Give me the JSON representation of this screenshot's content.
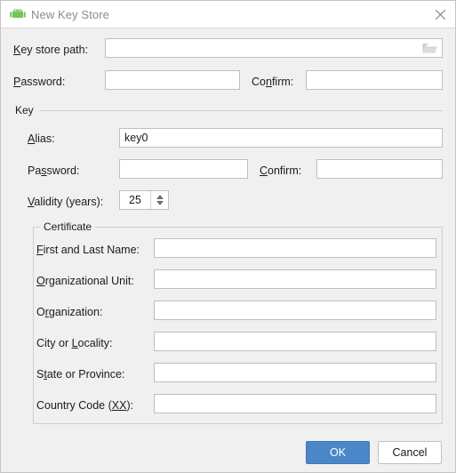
{
  "window": {
    "title": "New Key Store",
    "icon": "android-robot-icon",
    "close_icon": "close-icon"
  },
  "keystore": {
    "path_label_pre": "",
    "path_label_mnemonic": "K",
    "path_label_post": "ey store path:",
    "path_value": "",
    "browse_icon": "folder-icon",
    "password_label_mnemonic": "P",
    "password_label_post": "assword:",
    "password_value": "",
    "confirm_label_pre": "Co",
    "confirm_label_mnemonic": "n",
    "confirm_label_post": "firm:",
    "confirm_value": ""
  },
  "key_group": {
    "legend": "Key",
    "alias_label_mnemonic": "A",
    "alias_label_post": "lias:",
    "alias_value": "key0",
    "password_label_pre": "Pa",
    "password_label_mnemonic": "s",
    "password_label_post": "sword:",
    "password_value": "",
    "confirm_label_mnemonic": "C",
    "confirm_label_post": "onfirm:",
    "confirm_value": "",
    "validity_label_mnemonic": "V",
    "validity_label_post": "alidity (years):",
    "validity_value": "25",
    "spinner_up_icon": "chevron-up-icon",
    "spinner_down_icon": "chevron-down-icon"
  },
  "certificate_group": {
    "legend": "Certificate",
    "fields": [
      {
        "label_pre": "",
        "label_mnemonic": "F",
        "label_post": "irst and Last Name:",
        "value": ""
      },
      {
        "label_pre": "",
        "label_mnemonic": "O",
        "label_post": "rganizational Unit:",
        "value": ""
      },
      {
        "label_pre": "O",
        "label_mnemonic": "r",
        "label_post": "ganization:",
        "value": ""
      },
      {
        "label_pre": "City or ",
        "label_mnemonic": "L",
        "label_post": "ocality:",
        "value": ""
      },
      {
        "label_pre": "S",
        "label_mnemonic": "t",
        "label_post": "ate or Province:",
        "value": ""
      },
      {
        "label_pre": "Country Code (",
        "label_mnemonic": "XX",
        "label_post": "):",
        "value": ""
      }
    ]
  },
  "footer": {
    "ok_label": "OK",
    "cancel_label": "Cancel"
  },
  "colors": {
    "accent": "#4a86c8",
    "window_bg": "#f0f0f0",
    "titlebar_bg": "#ffffff",
    "field_bg": "#ffffff",
    "field_border": "#bfbfbf",
    "android_green": "#78c257"
  }
}
